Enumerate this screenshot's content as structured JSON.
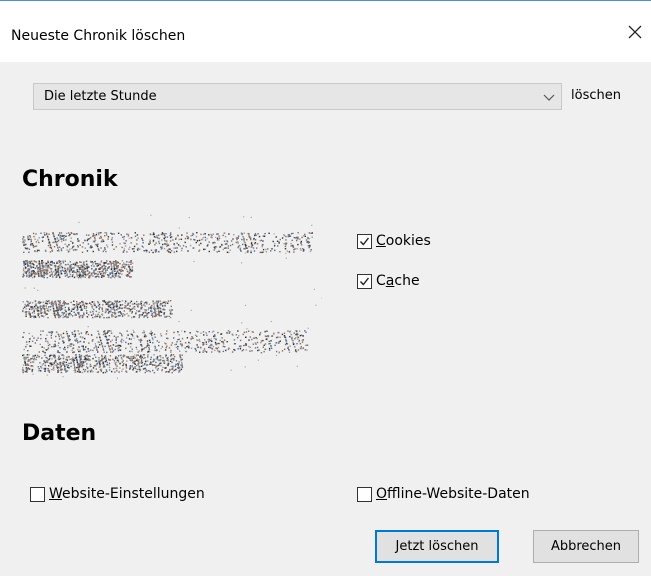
{
  "dialog": {
    "title": "Neueste Chronik löschen",
    "close_icon": "close-icon"
  },
  "timerange": {
    "selected": "Die letzte Stunde",
    "action_label": "löschen",
    "dropdown_icon": "chevron-down-icon"
  },
  "chronik": {
    "heading": "Chronik",
    "options": [
      {
        "label_mnemonic": "C",
        "label_rest": "ookies",
        "checked": true
      },
      {
        "label_prefix": "C",
        "label_mnemonic": "a",
        "label_rest": "che",
        "checked": true
      }
    ]
  },
  "daten": {
    "heading": "Daten",
    "options": [
      {
        "label_mnemonic": "W",
        "label_rest": "ebsite-Einstellungen",
        "checked": false
      },
      {
        "label_mnemonic": "O",
        "label_rest": "ffline-Website-Daten",
        "checked": false
      }
    ]
  },
  "buttons": {
    "clear_now": "Jetzt löschen",
    "cancel": "Abbrechen"
  },
  "colors": {
    "accent": "#0078d7",
    "dialog_bg": "#f0f0f0",
    "titlebar_bg": "#ffffff"
  }
}
